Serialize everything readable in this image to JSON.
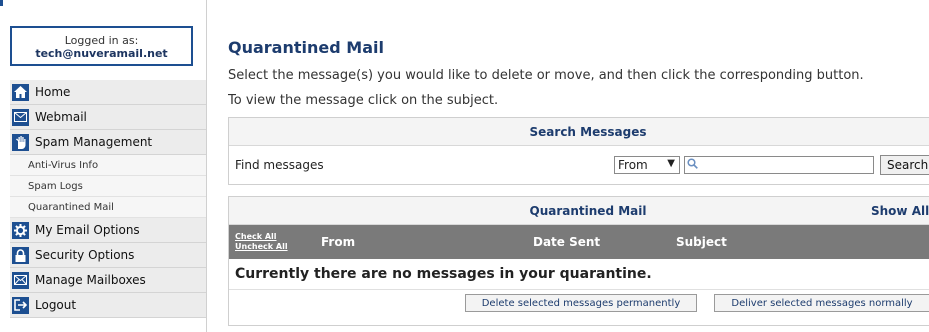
{
  "sidebar": {
    "login_label": "Logged in as:",
    "login_user": "tech@nuveramail.net",
    "items": {
      "home": "Home",
      "webmail": "Webmail",
      "spam_management": "Spam Management",
      "anti_virus": "Anti-Virus Info",
      "spam_logs": "Spam Logs",
      "quarantined_mail": "Quarantined Mail",
      "my_email_options": "My Email Options",
      "security_options": "Security Options",
      "manage_mailboxes": "Manage Mailboxes",
      "logout": "Logout"
    }
  },
  "main": {
    "title": "Quarantined Mail",
    "instruction_1": "Select the message(s) you would like to delete or move, and then click the corresponding button.",
    "instruction_2": "To view the message click on the subject.",
    "search": {
      "header": "Search Messages",
      "find_label": "Find messages",
      "field_select": "From",
      "query_value": "",
      "button_label": "Search"
    },
    "quarantine": {
      "header": "Quarantined Mail",
      "show_all": "Show All",
      "check_all": "Check All",
      "uncheck_all": "Uncheck All",
      "columns": {
        "from": "From",
        "date_sent": "Date Sent",
        "subject": "Subject"
      },
      "empty_message": "Currently there are no messages in your quarantine.",
      "delete_button": "Delete selected messages permanently",
      "deliver_button": "Deliver selected messages normally"
    }
  },
  "colors": {
    "accent": "#1d4f91",
    "title": "#1d3c6e",
    "column_header_bg": "#7a7a7a"
  }
}
